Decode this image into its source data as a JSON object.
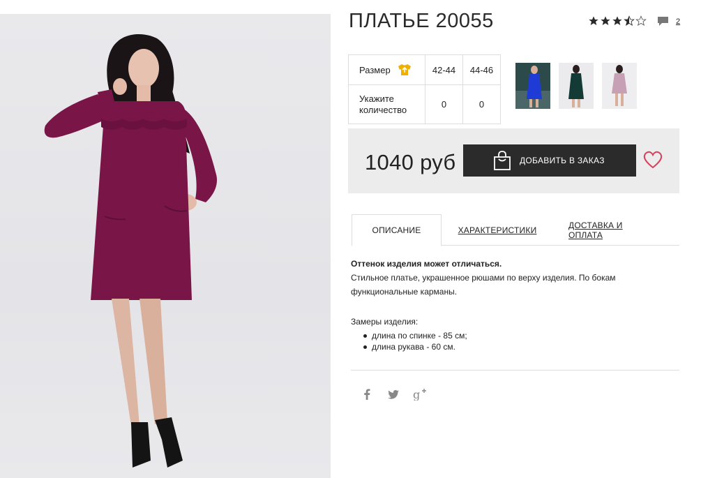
{
  "product": {
    "title": "ПЛАТЬЕ 20055",
    "rating": 3.5,
    "rating_max": 5,
    "comments_count": "2"
  },
  "sizes": {
    "size_label": "Размер",
    "size_options": [
      "42-44",
      "44-46"
    ],
    "quantity_label": "Укажите количество",
    "quantities": [
      "0",
      "0"
    ]
  },
  "thumbnails": [
    {
      "name": "thumbnail-blue",
      "color": "#1f3bd6"
    },
    {
      "name": "thumbnail-dark-green",
      "color": "#133a34"
    },
    {
      "name": "thumbnail-pink",
      "color": "#c7a0b6"
    }
  ],
  "buy": {
    "price": "1040 руб",
    "add_button_label": "ДОБАВИТЬ В ЗАКАЗ"
  },
  "tabs": [
    {
      "label": "ОПИСАНИЕ",
      "active": true
    },
    {
      "label": "ХАРАКТЕРИСТИКИ",
      "active": false
    },
    {
      "label": "ДОСТАВКА И ОПЛАТА",
      "active": false
    }
  ],
  "description": {
    "note": "Оттенок изделия может отличаться.",
    "text": "Стильное платье, украшенное рюшами по верху изделия. По бокам функциональные карманы.",
    "measure_title": "Замеры изделия:",
    "measures": [
      "длина по спинке - 85 см;",
      "длина рукава - 60 см."
    ]
  },
  "social": [
    "facebook-icon",
    "twitter-icon",
    "google-plus-icon"
  ],
  "colors": {
    "dress": "#7a1548",
    "button_bg": "#2b2b2b",
    "heart": "#d8405c",
    "shirt_icon": "#f0b000",
    "panel_bg": "#ececec"
  }
}
